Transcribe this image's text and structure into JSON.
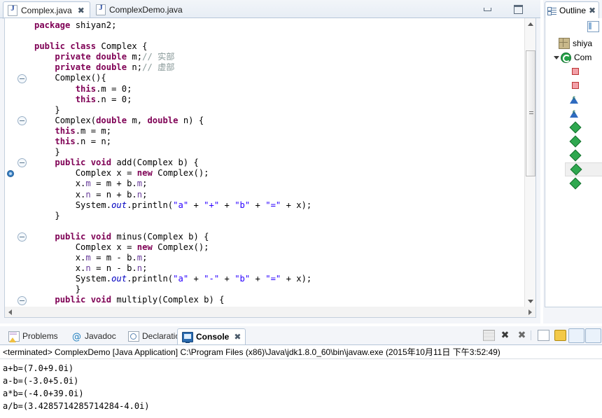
{
  "editor": {
    "tabs": [
      {
        "label": "Complex.java",
        "icon": "java-file-icon",
        "active": true,
        "close": "✖"
      },
      {
        "label": "ComplexDemo.java",
        "icon": "java-file-icon",
        "active": false,
        "close": ""
      }
    ],
    "window_buttons": {
      "minimize": "minimize-button",
      "maximize": "maximize-button"
    },
    "code_lines": [
      {
        "indent": 1,
        "segments": [
          {
            "t": "package ",
            "c": "k"
          },
          {
            "t": "shiyan2;",
            "c": "plain"
          }
        ]
      },
      {
        "indent": 0,
        "segments": []
      },
      {
        "indent": 1,
        "segments": [
          {
            "t": "public class ",
            "c": "k"
          },
          {
            "t": "Complex {",
            "c": "plain"
          }
        ]
      },
      {
        "indent": 2,
        "segments": [
          {
            "t": "private double ",
            "c": "k"
          },
          {
            "t": "m;",
            "c": "plain"
          },
          {
            "t": "// 实部",
            "c": "cm"
          }
        ]
      },
      {
        "indent": 2,
        "segments": [
          {
            "t": "private double ",
            "c": "k"
          },
          {
            "t": "n;",
            "c": "plain"
          },
          {
            "t": "// 虚部",
            "c": "cm"
          }
        ]
      },
      {
        "indent": 2,
        "segments": [
          {
            "t": "Complex(){",
            "c": "plain"
          }
        ]
      },
      {
        "indent": 3,
        "segments": [
          {
            "t": "this",
            "c": "k"
          },
          {
            "t": ".m = 0;",
            "c": "plain"
          }
        ]
      },
      {
        "indent": 3,
        "segments": [
          {
            "t": "this",
            "c": "k"
          },
          {
            "t": ".n = 0;",
            "c": "plain"
          }
        ]
      },
      {
        "indent": 2,
        "segments": [
          {
            "t": "}",
            "c": "plain"
          }
        ]
      },
      {
        "indent": 2,
        "segments": [
          {
            "t": "Complex(",
            "c": "plain"
          },
          {
            "t": "double ",
            "c": "k"
          },
          {
            "t": "m, ",
            "c": "plain"
          },
          {
            "t": "double ",
            "c": "k"
          },
          {
            "t": "n) {",
            "c": "plain"
          }
        ]
      },
      {
        "indent": 2,
        "segments": [
          {
            "t": "this",
            "c": "k"
          },
          {
            "t": ".m = m;",
            "c": "plain"
          }
        ]
      },
      {
        "indent": 2,
        "segments": [
          {
            "t": "this",
            "c": "k"
          },
          {
            "t": ".n = n;",
            "c": "plain"
          }
        ]
      },
      {
        "indent": 2,
        "segments": [
          {
            "t": "}",
            "c": "plain"
          }
        ]
      },
      {
        "indent": 2,
        "segments": [
          {
            "t": "public void ",
            "c": "k"
          },
          {
            "t": "add(Complex b) {",
            "c": "plain"
          }
        ]
      },
      {
        "indent": 3,
        "segments": [
          {
            "t": "Complex x = ",
            "c": "plain"
          },
          {
            "t": "new ",
            "c": "k"
          },
          {
            "t": "Complex();",
            "c": "plain"
          }
        ]
      },
      {
        "indent": 3,
        "segments": [
          {
            "t": "x.",
            "c": "plain"
          },
          {
            "t": "m",
            "c": "lv"
          },
          {
            "t": " = m + b.",
            "c": "plain"
          },
          {
            "t": "m",
            "c": "lv"
          },
          {
            "t": ";",
            "c": "plain"
          }
        ]
      },
      {
        "indent": 3,
        "segments": [
          {
            "t": "x.",
            "c": "plain"
          },
          {
            "t": "n",
            "c": "lv"
          },
          {
            "t": " = n + b.",
            "c": "plain"
          },
          {
            "t": "n",
            "c": "lv"
          },
          {
            "t": ";",
            "c": "plain"
          }
        ]
      },
      {
        "indent": 3,
        "segments": [
          {
            "t": "System.",
            "c": "plain"
          },
          {
            "t": "out",
            "c": "fi"
          },
          {
            "t": ".println(",
            "c": "plain"
          },
          {
            "t": "\"a\"",
            "c": "st"
          },
          {
            "t": " + ",
            "c": "plain"
          },
          {
            "t": "\"+\"",
            "c": "st"
          },
          {
            "t": " + ",
            "c": "plain"
          },
          {
            "t": "\"b\"",
            "c": "st"
          },
          {
            "t": " + ",
            "c": "plain"
          },
          {
            "t": "\"=\"",
            "c": "st"
          },
          {
            "t": " + x);",
            "c": "plain"
          }
        ]
      },
      {
        "indent": 2,
        "segments": [
          {
            "t": "}",
            "c": "plain"
          }
        ]
      },
      {
        "indent": 0,
        "segments": []
      },
      {
        "indent": 2,
        "segments": [
          {
            "t": "public void ",
            "c": "k"
          },
          {
            "t": "minus(Complex b) {",
            "c": "plain"
          }
        ]
      },
      {
        "indent": 3,
        "segments": [
          {
            "t": "Complex x = ",
            "c": "plain"
          },
          {
            "t": "new ",
            "c": "k"
          },
          {
            "t": "Complex();",
            "c": "plain"
          }
        ]
      },
      {
        "indent": 3,
        "segments": [
          {
            "t": "x.",
            "c": "plain"
          },
          {
            "t": "m",
            "c": "lv"
          },
          {
            "t": " = m - b.",
            "c": "plain"
          },
          {
            "t": "m",
            "c": "lv"
          },
          {
            "t": ";",
            "c": "plain"
          }
        ]
      },
      {
        "indent": 3,
        "segments": [
          {
            "t": "x.",
            "c": "plain"
          },
          {
            "t": "n",
            "c": "lv"
          },
          {
            "t": " = n - b.",
            "c": "plain"
          },
          {
            "t": "n",
            "c": "lv"
          },
          {
            "t": ";",
            "c": "plain"
          }
        ]
      },
      {
        "indent": 3,
        "segments": [
          {
            "t": "System.",
            "c": "plain"
          },
          {
            "t": "out",
            "c": "fi"
          },
          {
            "t": ".println(",
            "c": "plain"
          },
          {
            "t": "\"a\"",
            "c": "st"
          },
          {
            "t": " + ",
            "c": "plain"
          },
          {
            "t": "\"-\"",
            "c": "st"
          },
          {
            "t": " + ",
            "c": "plain"
          },
          {
            "t": "\"b\"",
            "c": "st"
          },
          {
            "t": " + ",
            "c": "plain"
          },
          {
            "t": "\"=\"",
            "c": "st"
          },
          {
            "t": " + x);",
            "c": "plain"
          }
        ]
      },
      {
        "indent": 3,
        "segments": [
          {
            "t": "}",
            "c": "plain"
          }
        ]
      },
      {
        "indent": 2,
        "segments": [
          {
            "t": "public void ",
            "c": "k"
          },
          {
            "t": "multiply(Complex b) {",
            "c": "plain"
          }
        ]
      }
    ],
    "fold_rows": [
      5,
      9,
      13,
      20,
      26
    ],
    "breakpoint_row": 14,
    "scrollbar": {
      "thumb_top_pct": 8,
      "thumb_height_pct": 47
    }
  },
  "outline": {
    "title": "Outline",
    "close": "✖",
    "rows": [
      {
        "label": "shiya",
        "icon": "package-icon",
        "indent": 26,
        "twisty": "none",
        "selected": false
      },
      {
        "label": "Com",
        "icon": "class-icon",
        "indent": 26,
        "twisty": "down",
        "selected": false
      },
      {
        "label": "",
        "icon": "private-field-icon",
        "indent": 42,
        "twisty": "none",
        "selected": false
      },
      {
        "label": "",
        "icon": "private-field-icon",
        "indent": 42,
        "twisty": "none",
        "selected": false
      },
      {
        "label": "",
        "icon": "constructor-icon",
        "indent": 42,
        "twisty": "none",
        "selected": false,
        "sup": "c"
      },
      {
        "label": "",
        "icon": "constructor-icon",
        "indent": 42,
        "twisty": "none",
        "selected": false,
        "sup": "c"
      },
      {
        "label": "",
        "icon": "method-icon",
        "indent": 42,
        "twisty": "none",
        "selected": false
      },
      {
        "label": "",
        "icon": "method-icon",
        "indent": 42,
        "twisty": "none",
        "selected": false
      },
      {
        "label": "",
        "icon": "method-icon",
        "indent": 42,
        "twisty": "none",
        "selected": false
      },
      {
        "label": "",
        "icon": "method-icon",
        "indent": 42,
        "twisty": "none",
        "selected": true
      },
      {
        "label": "",
        "icon": "method-icon",
        "indent": 42,
        "twisty": "none",
        "selected": false
      }
    ]
  },
  "bottom_view": {
    "tabs": [
      {
        "label": "Problems",
        "icon": "problems-icon",
        "active": false,
        "close": ""
      },
      {
        "label": "Javadoc",
        "icon": "javadoc-icon",
        "active": false,
        "close": ""
      },
      {
        "label": "Declaration",
        "icon": "declaration-icon",
        "active": false,
        "close": ""
      },
      {
        "label": "Console",
        "icon": "console-icon",
        "active": true,
        "close": "✖"
      }
    ],
    "toolbar": [
      "clear-console-icon",
      "terminate-icon",
      "remove-all-terminated-icon",
      "open-console-icon",
      "lock-scroll-icon",
      "display-selected-console-icon",
      "pin-console-icon"
    ],
    "console": {
      "header": "<terminated> ComplexDemo [Java Application] C:\\Program Files (x86)\\Java\\jdk1.8.0_60\\bin\\javaw.exe (2015年10月11日 下午3:52:49)",
      "output": "a+b=(7.0+9.0i)\na-b=(-3.0+5.0i)\na*b=(-4.0+39.0i)\na/b=(3.4285714285714284-4.0i)"
    }
  },
  "colors": {
    "keyword": "#7f0055",
    "string": "#2a00ff",
    "comment": "#8a9a9a",
    "static_field": "#0000c0",
    "field_ref": "#6a3e9c",
    "tab_border": "#b6c6d9",
    "chrome_bg": "#f3f5f9"
  }
}
